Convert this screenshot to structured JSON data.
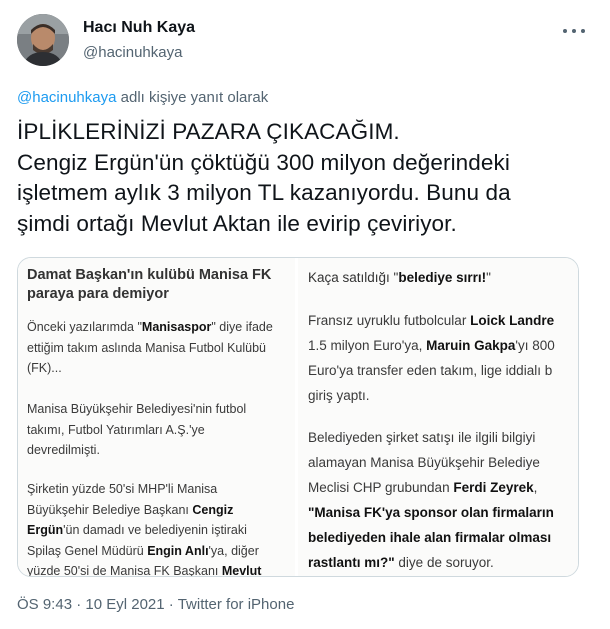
{
  "author": {
    "display_name": "Hacı Nuh Kaya",
    "handle": "@hacinuhkaya"
  },
  "reply_context": {
    "mention": "@hacinuhkaya",
    "suffix": " adlı kişiye yanıt olarak"
  },
  "tweet": {
    "lines": [
      "İPLİKLERİNİZİ PAZARA ÇIKACAĞIM.",
      "Cengiz Ergün'ün çöktüğü 300 milyon değerindeki",
      "işletmem aylık 3 milyon TL kazanıyordu. Bunu da",
      "şimdi ortağı Mevlut Aktan ile evirip çeviriyor."
    ]
  },
  "media": {
    "left": {
      "headline_1": "Damat Başkan'ın kulübü Manisa FK",
      "headline_2": "paraya para demiyor",
      "p1_l1_a": "Önceki yazılarımda \"",
      "p1_l1_b": "Manisaspor",
      "p1_l1_c": "\" diye ifade",
      "p1_l2": "ettiğim takım aslında Manisa Futbol Kulübü",
      "p1_l3": "(FK)...",
      "p2_l1": "Manisa Büyükşehir Belediyesi'nin futbol",
      "p2_l2": "takımı, Futbol Yatırımları A.Ş.'ye",
      "p2_l3": "devredilmişti.",
      "p3_l1": "Şirketin yüzde 50'si MHP'li Manisa",
      "p3_l2_a": "Büyükşehir Belediye Başkanı ",
      "p3_l2_b": "Cengiz",
      "p3_l3_a": "Ergün",
      "p3_l3_b": "'ün damadı ve belediyenin iştiraki",
      "p3_l4_a": "Spilaş Genel Müdürü ",
      "p3_l4_b": "Engin Anlı",
      "p3_l4_c": "'ya, diğer",
      "p3_l5_a": "yüzde 50'si de Manisa FK Başkanı ",
      "p3_l5_b": "Mevlut"
    },
    "right": {
      "head_a": "Kaça satıldığı \"",
      "head_b": "belediye sırrı!",
      "head_c": "\"",
      "p1_l1_a": "Fransız uyruklu futbolcular ",
      "p1_l1_b": "Loick Landre",
      "p1_l2_a": "1.5 milyon Euro'ya, ",
      "p1_l2_b": "Maruin Gakpa",
      "p1_l2_c": "'yı 800",
      "p1_l3": "Euro'ya transfer eden takım, lige iddialı b",
      "p1_l4": "giriş yaptı.",
      "p2_l1": "Belediyeden şirket satışı ile ilgili bilgiyi",
      "p2_l2": "alamayan Manisa Büyükşehir Belediye",
      "p2_l3_a": "Meclisi CHP grubundan ",
      "p2_l3_b": "Ferdi Zeyrek",
      "p2_l3_c": ",",
      "p2_l4": "\"Manisa FK'ya sponsor olan firmaların",
      "p2_l5": "belediyeden ihale alan firmalar olması",
      "p2_l6_a": "rastlantı mı?\"",
      "p2_l6_b": " diye de soruyor."
    }
  },
  "meta": {
    "time": "ÖS 9:43",
    "sep1": " · ",
    "date": "10 Eyl 2021",
    "sep2": " · ",
    "source": "Twitter for iPhone"
  },
  "colors": {
    "link": "#1d9bf0",
    "secondary_text": "#536471",
    "primary_text": "#0f1419",
    "border": "#cfd9de"
  },
  "icons": [
    "avatar",
    "more-options-icon"
  ]
}
